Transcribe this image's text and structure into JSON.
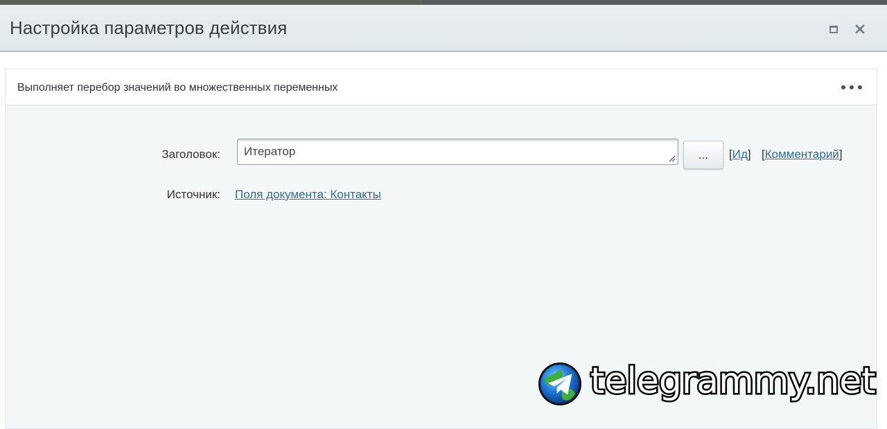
{
  "window": {
    "title": "Настройка параметров действия"
  },
  "panel": {
    "description": "Выполняет перебор значений во множественных переменных"
  },
  "form": {
    "title_label": "Заголовок:",
    "title_value": "Итератор",
    "dots_button_label": "...",
    "id_link": "Ид",
    "comment_link": "Комментарий",
    "source_label": "Источник:",
    "source_link": "Поля документа: Контакты"
  },
  "watermark": {
    "text": "telegrammy.net"
  },
  "icons": {
    "maximize": "maximize-icon",
    "close": "close-icon",
    "more": "more-horizontal-icon",
    "resize": "resize-grip-icon",
    "telegram": "telegram-logo-icon"
  },
  "colors": {
    "link": "#2d6fa3",
    "titlebar": "#e5ebee",
    "panel_bg": "#f4f7f8"
  }
}
